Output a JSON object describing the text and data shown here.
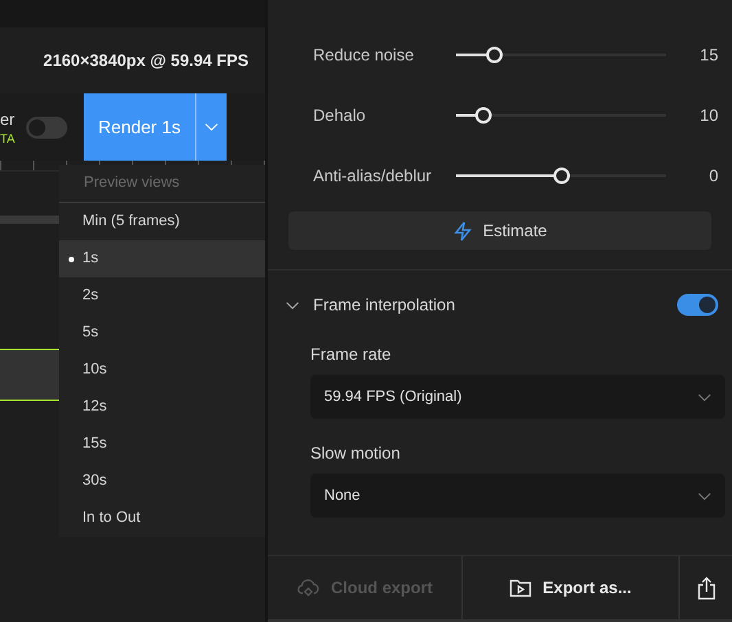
{
  "left": {
    "resolution": "2160×3840px @ 59.94 FPS",
    "label_fragment": "er",
    "badge_fragment": "TA",
    "toggle_on": false,
    "render_button": "Render 1s",
    "menu": {
      "header": "Preview views",
      "items": [
        {
          "label": "Min (5 frames)",
          "selected": false
        },
        {
          "label": "1s",
          "selected": true
        },
        {
          "label": "2s",
          "selected": false
        },
        {
          "label": "5s",
          "selected": false
        },
        {
          "label": "10s",
          "selected": false
        },
        {
          "label": "12s",
          "selected": false
        },
        {
          "label": "15s",
          "selected": false
        },
        {
          "label": "30s",
          "selected": false
        },
        {
          "label": "In to Out",
          "selected": false
        }
      ]
    }
  },
  "right": {
    "sliders": [
      {
        "label": "Reduce noise",
        "level": 0.18,
        "value": "15"
      },
      {
        "label": "Dehalo",
        "level": 0.13,
        "value": "10"
      },
      {
        "label": "Anti-alias/deblur",
        "level": 0.5,
        "value": "0"
      }
    ],
    "estimate_button": "Estimate",
    "section": {
      "title": "Frame interpolation",
      "expanded": true,
      "on": true,
      "fields": [
        {
          "label": "Frame rate",
          "value": "59.94 FPS (Original)"
        },
        {
          "label": "Slow motion",
          "value": "None"
        }
      ]
    }
  },
  "footer": {
    "cloud_export": {
      "label": "Cloud export",
      "disabled": true
    },
    "export_button": "Export as..."
  }
}
